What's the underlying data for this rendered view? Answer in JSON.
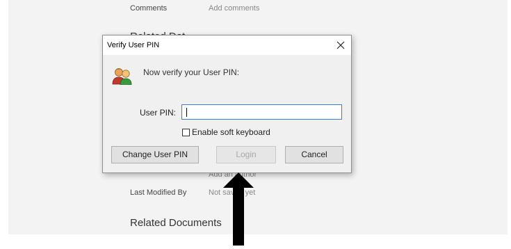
{
  "background": {
    "comments_label": "Comments",
    "comments_value": "Add comments",
    "related_dates_partial": "Related Dat",
    "author_partial": "Add an author",
    "last_modified_label": "Last Modified By",
    "last_modified_value": "Not saved yet",
    "related_docs_heading": "Related Documents"
  },
  "dialog": {
    "title": "Verify User PIN",
    "prompt": "Now verify your User PIN:",
    "pin_label": "User PIN:",
    "pin_value": "",
    "soft_keyboard_label": "Enable soft keyboard",
    "soft_keyboard_checked": false,
    "buttons": {
      "change_pin": "Change User PIN",
      "login": "Login",
      "cancel": "Cancel"
    },
    "login_enabled": false
  },
  "icons": {
    "close": "close-icon",
    "users": "users-icon",
    "annotation_arrow": "up-arrow-icon"
  },
  "colors": {
    "input_focus_border": "#3a7bd5",
    "dialog_bg": "#f0f0f0",
    "disabled_text": "#a8a8a8"
  }
}
